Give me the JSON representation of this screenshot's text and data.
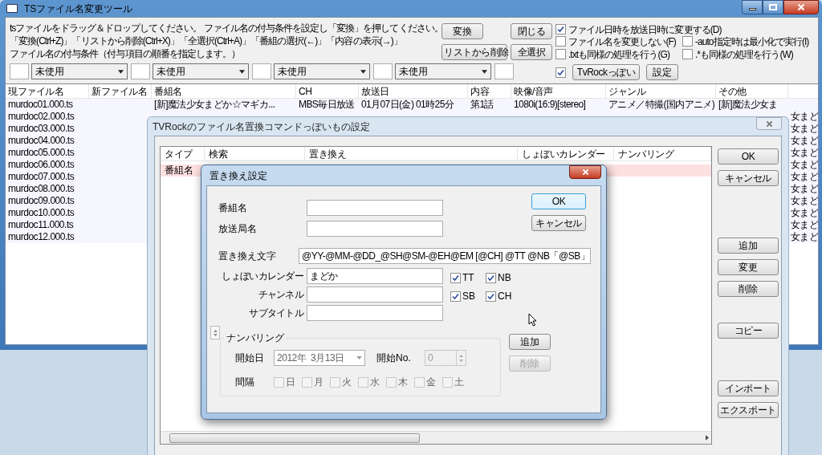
{
  "main_window": {
    "title": "TSファイル名変更ツール",
    "instructions": [
      "tsファイルをドラッグ＆ドロップしてください。 ファイル名の付与条件を設定し「変換」を押してください。",
      "「変換(Ctrl+Z)」「リストから削除(Ctrl+X)」「全選択(Ctrl+A)」「番組の選択(←)」「内容の表示(→)」",
      "ファイル名の付与条件（付与項目の順番を指定します。）"
    ],
    "buttons": [
      "変換",
      "閉じる",
      "リストから削除",
      "全選択"
    ],
    "options": [
      {
        "label": "ファイル日時を放送日時に変更する(D)",
        "checked": true
      },
      {
        "label": "ファイル名を変更しない(F)",
        "checked": false
      },
      {
        "label": "-auto指定時は最小化で実行(I)",
        "checked": false
      },
      {
        "label": ".txtも同様の処理を行う(G)",
        "checked": false
      },
      {
        "label": ".*も同様の処理を行う(W)",
        "checked": false
      }
    ],
    "tvrock_option": {
      "checked": true,
      "button": "TvRockっぽい"
    },
    "settings_button": "設定",
    "order_slots": [
      "未使用",
      "未使用",
      "未使用",
      "未使用"
    ],
    "table": {
      "columns": [
        "現ファイル名",
        "新ファイル名",
        "番組名",
        "CH",
        "放送日",
        "内容",
        "映像/音声",
        "ジャンル",
        "その他"
      ],
      "rows": [
        {
          "file": "murdoc01.000.ts",
          "program": "[新]魔法少女まどか☆マギカ...",
          "ch": "MBS毎日放送",
          "date": "01月07日(金) 01時25分",
          "content": "第1話",
          "av": "1080i(16:9)[stereo]",
          "genre": "アニメ／特撮(国内アニメ)",
          "other": "[新]魔法少女ま"
        },
        {
          "file": "murdoc02.000.ts",
          "other": "女まど"
        },
        {
          "file": "murdoc03.000.ts",
          "other": "女まど"
        },
        {
          "file": "murdoc04.000.ts",
          "other": "女まど"
        },
        {
          "file": "murdoc05.000.ts",
          "other": "女まど"
        },
        {
          "file": "murdoc06.000.ts",
          "other": "女まど"
        },
        {
          "file": "murdoc07.000.ts",
          "other": "女まど"
        },
        {
          "file": "murdoc08.000.ts",
          "other": "女まど"
        },
        {
          "file": "murdoc09.000.ts",
          "other": "女まど"
        },
        {
          "file": "murdoc10.000.ts",
          "other": "女まど"
        },
        {
          "file": "murdoc11.000.ts",
          "other": "女まど"
        },
        {
          "file": "murdoc12.000.ts",
          "other": "女まど"
        }
      ]
    }
  },
  "replace_window": {
    "title": "TVRockのファイル名置換コマンドっぽいもの設定",
    "columns": [
      "タイプ",
      "検索",
      "置き換え",
      "しょぼいカレンダー",
      "ナンバリング"
    ],
    "rows": [
      {
        "type": "番組名",
        "selected": true
      }
    ],
    "buttons": [
      "OK",
      "キャンセル",
      "追加",
      "変更",
      "削除",
      "コピー",
      "インポート",
      "エクスポート"
    ]
  },
  "edit_dialog": {
    "title": "置き換え設定",
    "fields": [
      {
        "label": "番組名"
      },
      {
        "label": "放送局名"
      }
    ],
    "replace_text": {
      "label": "置き換え文字",
      "value": "@YY-@MM-@DD_@SH@SM-@EH@EM [@CH] @TT @NB「@SB」"
    },
    "lower_fields": [
      {
        "label": "しょぼいカレンダー",
        "value": "まどか"
      },
      {
        "label": "チャンネル"
      },
      {
        "label": "サブタイトル"
      }
    ],
    "flags": [
      {
        "label": "TT",
        "checked": true
      },
      {
        "label": "NB",
        "checked": true
      },
      {
        "label": "SB",
        "checked": true
      },
      {
        "label": "CH",
        "checked": true
      }
    ],
    "buttons": [
      "OK",
      "キャンセル"
    ],
    "numbering": {
      "legend": "ナンバリング",
      "start_date": {
        "label": "開始日",
        "value": "2012年  3月13日",
        "disabled": true
      },
      "start_no": {
        "label": "開始No.",
        "value": "0",
        "disabled": true
      },
      "interval": {
        "label": "間隔",
        "days": [
          {
            "label": "日",
            "checked": false
          },
          {
            "label": "月",
            "checked": false
          },
          {
            "label": "火",
            "checked": false
          },
          {
            "label": "水",
            "checked": false
          },
          {
            "label": "木",
            "checked": false
          },
          {
            "label": "金",
            "checked": false
          },
          {
            "label": "土",
            "checked": false
          }
        ]
      },
      "buttons": [
        {
          "label": "追加",
          "disabled": false
        },
        {
          "label": "削除",
          "disabled": true
        }
      ]
    }
  }
}
